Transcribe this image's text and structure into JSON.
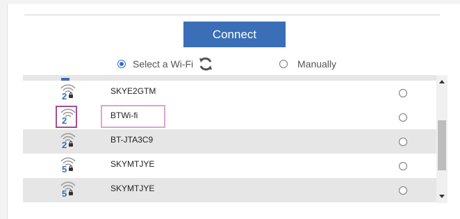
{
  "connect_label": "Connect",
  "modes": [
    {
      "label": "Select a Wi-Fi",
      "selected": true,
      "icon": "refresh-icon"
    },
    {
      "label": "Manually",
      "selected": false
    }
  ],
  "networks": [
    {
      "ssid": "SKYE2GTM",
      "band": "2",
      "secured": true,
      "selected": false,
      "shaded": false,
      "highlighted": false,
      "icon": "wifi-icon"
    },
    {
      "ssid": "BTWi-fi",
      "band": "2",
      "secured": false,
      "selected": false,
      "shaded": false,
      "highlighted": true,
      "icon": "wifi-icon"
    },
    {
      "ssid": "BT-JTA3C9",
      "band": "2",
      "secured": true,
      "selected": false,
      "shaded": true,
      "highlighted": false,
      "icon": "wifi-icon"
    },
    {
      "ssid": "SKYMTJYE",
      "band": "5",
      "secured": true,
      "selected": false,
      "shaded": false,
      "highlighted": false,
      "icon": "wifi-icon"
    },
    {
      "ssid": "SKYMTJYE",
      "band": "5",
      "secured": true,
      "selected": false,
      "shaded": true,
      "highlighted": false,
      "icon": "wifi-icon"
    }
  ],
  "colors": {
    "accent": "#3a6fb7",
    "highlight_icon": "#a24d91",
    "highlight_ssid": "#d9a5d2",
    "row_shade": "#e6e6e6"
  }
}
